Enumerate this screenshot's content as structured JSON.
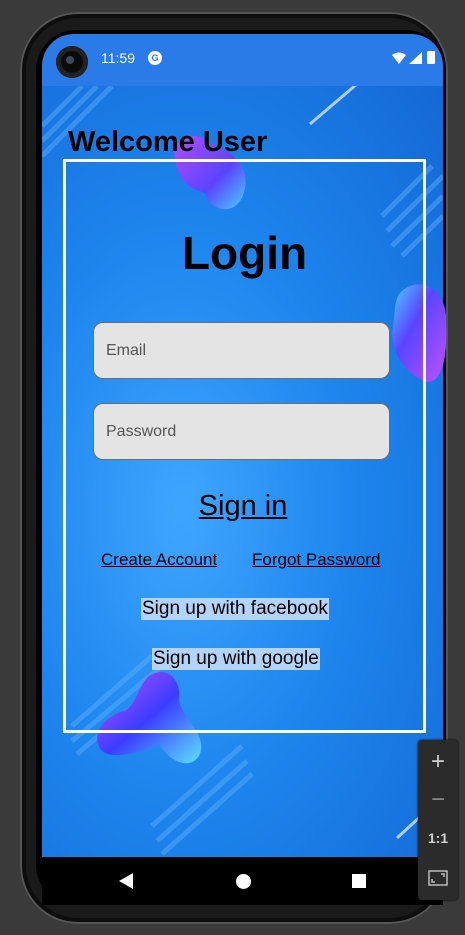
{
  "status_bar": {
    "time": "11:59",
    "app_badge": "G"
  },
  "app": {
    "welcome_text": "Welcome User",
    "login_title": "Login",
    "email_placeholder": "Email",
    "password_placeholder": "Password",
    "sign_in_label": "Sign in",
    "create_account_label": "Create Account",
    "forgot_password_label": "Forgot Password",
    "facebook_label": "Sign up with facebook",
    "google_label": "Sign up with google"
  },
  "zoom_panel": {
    "zoom_in": "+",
    "zoom_out": "−",
    "one_to_one": "1:1"
  },
  "colors": {
    "background_blue": "#1e86ee",
    "social_highlight": "#b4d4f7",
    "blob_purple": "#9a4dff",
    "blob_cyan": "#4fc6ff"
  },
  "icons": [
    "wifi-icon",
    "signal-icon",
    "battery-icon",
    "back-icon",
    "home-icon",
    "recents-icon",
    "fit-screen-icon"
  ]
}
